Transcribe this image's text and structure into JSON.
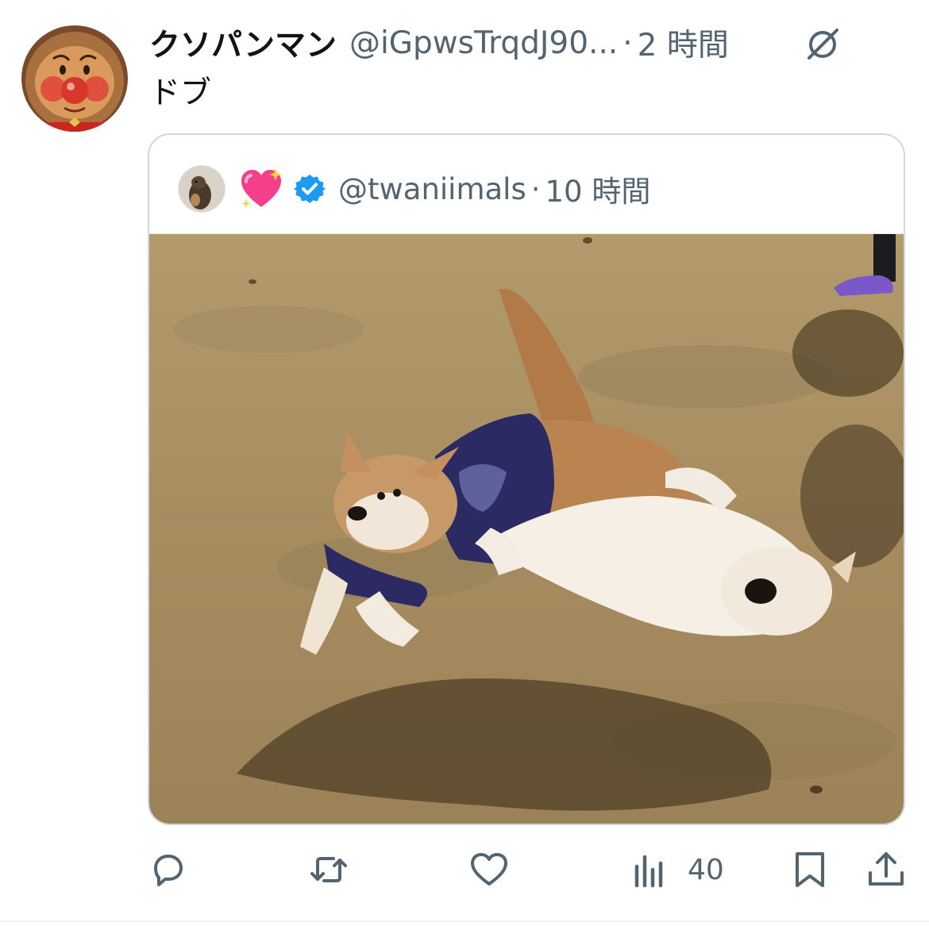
{
  "tweet": {
    "display_name": "クソパンマン",
    "handle": "@iGpwsTrqdJ90...",
    "separator": "·",
    "time": "2 時間",
    "text": "ドブ",
    "avatar_icon": "anpanman-avatar"
  },
  "quote": {
    "emoji": "sparkling-heart-icon",
    "verified_icon": "verified-badge-icon",
    "handle": "@twaniimals",
    "separator": "·",
    "time": "10 時間",
    "image": "photo-two-shiba-inu-dogs-playing-on-grass"
  },
  "actions": {
    "reply_icon": "reply-icon",
    "retweet_icon": "retweet-icon",
    "like_icon": "like-icon",
    "views_icon": "views-icon",
    "views_count": "40",
    "bookmark_icon": "bookmark-icon",
    "share_icon": "share-icon"
  },
  "colors": {
    "text_primary": "#0f1419",
    "text_secondary": "#536471",
    "verified_blue": "#1d9bf0",
    "border": "#cfd9de"
  }
}
